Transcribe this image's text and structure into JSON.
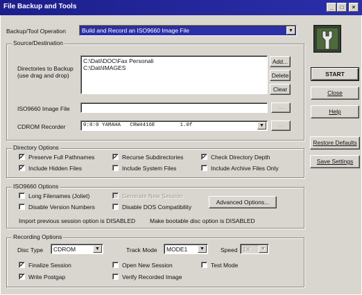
{
  "window": {
    "title": "File Backup and Tools",
    "controls": [
      "minimize",
      "maximize",
      "close"
    ]
  },
  "operation": {
    "label": "Backup/Tool Operation",
    "value": "Build and Record an ISO9660 Image File"
  },
  "source": {
    "group_title": "Source/Destination",
    "dirs_label_1": "Directories to Backup",
    "dirs_label_2": "(use drag and drop)",
    "dirs": [
      "C:\\Dati\\DOC\\Fax Personali",
      "C:\\Dati\\IMAGES"
    ],
    "add_label": "Add...",
    "delete_label": "Delete",
    "clear_label": "Clear",
    "iso_label": "ISO9660 Image File",
    "iso_value": "",
    "browse_label": "...",
    "recorder_label": "CDROM Recorder",
    "recorder_value": "0:0:0 YAMAHA   CRW4416E        1.0f"
  },
  "sidebar": {
    "start_label": "START",
    "close_label": "Close",
    "help_label": "Help",
    "restore_label": "Restore Defaults",
    "save_label": "Save Settings"
  },
  "directory_options": {
    "group_title": "Directory Options",
    "items": [
      {
        "label": "Preserve Full Pathnames",
        "checked": true
      },
      {
        "label": "Recurse Subdirectories",
        "checked": true
      },
      {
        "label": "Check Directory Depth",
        "checked": true
      },
      {
        "label": "Include Hidden Files",
        "checked": true
      },
      {
        "label": "Include System Files",
        "checked": false
      },
      {
        "label": "Include Archive Files Only",
        "checked": false
      }
    ]
  },
  "iso_options": {
    "group_title": "ISO9660 Options",
    "long_filenames": "Long Filenames (Joliet)",
    "disable_version": "Disable Version Numbers",
    "multisession": "Generate New Session",
    "disable_dos": "Disable DOS Compatibility",
    "advanced_label": "Advanced Options...",
    "info_import": "Import previous session option is DISABLED",
    "info_boot": "Make bootable disc option is DISABLED"
  },
  "recording_options": {
    "group_title": "Recording Options",
    "disc_type_label": "Disc Type",
    "disc_type_value": "CDROM",
    "track_mode_label": "Track Mode",
    "track_mode_value": "MODE1",
    "speed_label": "Speed",
    "speed_value": "1X",
    "finalize": {
      "label": "Finalize Session",
      "checked": true
    },
    "open_new": {
      "label": "Open New Session",
      "checked": false
    },
    "test_mode": {
      "label": "Test Mode",
      "checked": false
    },
    "write_postgap": {
      "label": "Write Postgap",
      "checked": true
    },
    "verify": {
      "label": "Verify Recorded Image",
      "checked": false
    }
  },
  "check_glyph": "✓",
  "arrow_glyph": "▼",
  "colors": {
    "titlebar": "#1c1e8c",
    "selection": "#2b2fa8",
    "face": "#d9d6cf"
  }
}
